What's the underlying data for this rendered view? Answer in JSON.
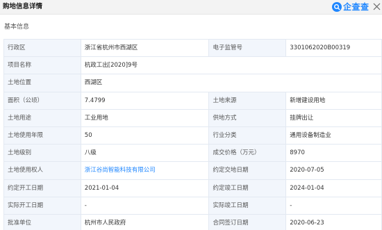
{
  "header": {
    "title": "购地信息详情",
    "brand": "企查查"
  },
  "section": {
    "title": "基本信息"
  },
  "rows": [
    {
      "l1": "行政区",
      "v1": "浙江省杭州市西湖区",
      "l2": "电子监管号",
      "v2": "3301062020B00319"
    },
    {
      "l1": "项目名称",
      "v1": "杭政工出[2020]9号"
    },
    {
      "l1": "土地位置",
      "v1": "西湖区"
    },
    {
      "l1": "面积（公顷）",
      "v1": "7.4799",
      "l2": "土地来源",
      "v2": "新增建设用地"
    },
    {
      "l1": "土地用途",
      "v1": "工业用地",
      "l2": "供地方式",
      "v2": "挂牌出让"
    },
    {
      "l1": "土地使用年限",
      "v1": "50",
      "l2": "行业分类",
      "v2": "通用设备制造业"
    },
    {
      "l1": "土地级别",
      "v1": "八级",
      "l2": "成交价格（万元）",
      "v2": "8970"
    },
    {
      "l1": "土地使用权人",
      "v1": "浙江谷尚智能科技有限公司",
      "l2": "约定交地日期",
      "v2": "2020-07-05"
    },
    {
      "l1": "约定开工日期",
      "v1": "2021-01-04",
      "l2": "约定竣工日期",
      "v2": "2024-01-04"
    },
    {
      "l1": "实际开工日期",
      "v1": "-",
      "l2": "实际竣工日期",
      "v2": "-"
    },
    {
      "l1": "批准单位",
      "v1": "杭州市人民政府",
      "l2": "合同签订日期",
      "v2": "2020-06-23"
    }
  ],
  "colors": {
    "label_bg": "#f2f6fc",
    "border": "#e3e9f2",
    "link": "#1e86ff",
    "brand": "#1e86ff"
  },
  "icons": {
    "brand_logo": "qichacha-logo-icon",
    "close": "close-icon"
  }
}
